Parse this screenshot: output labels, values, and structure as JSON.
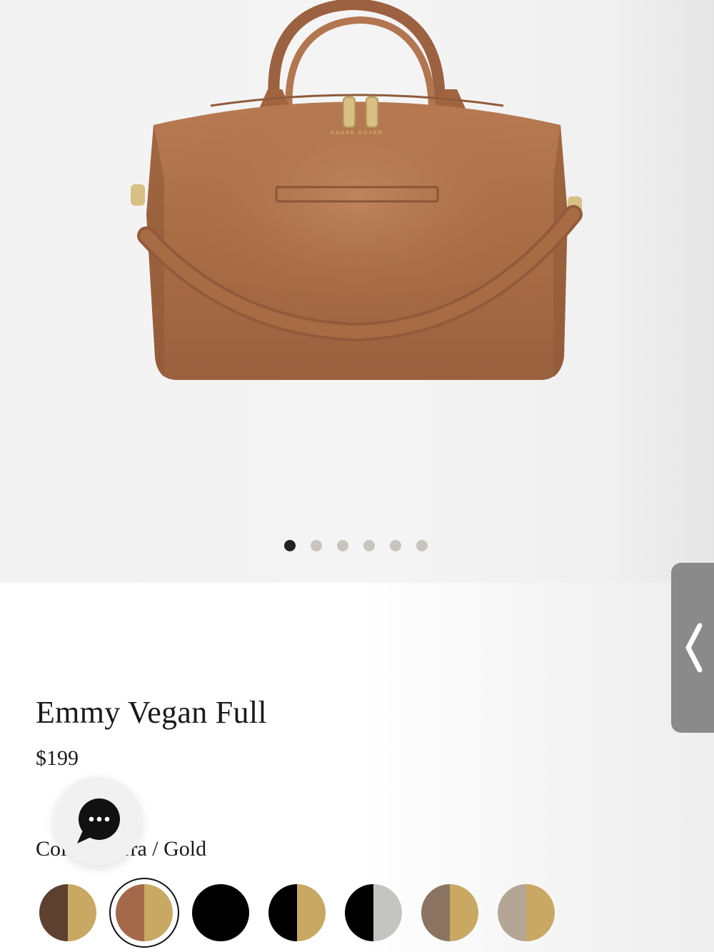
{
  "product": {
    "title": "Emmy Vegan Full",
    "price": "$199",
    "color_label": "Color: Sierra / Gold",
    "brand_mark": "DAGNE DOVER"
  },
  "gallery": {
    "image_count": 6,
    "active_index": 0
  },
  "icons": {
    "chat": "chat-bubble-icon",
    "side_handle": "chevron-left-icon"
  },
  "swatches": [
    {
      "name": "dark-brown-gold",
      "left": "#5e4030",
      "right": "#c8a862",
      "selected": false
    },
    {
      "name": "sierra-gold",
      "left": "#a4694a",
      "right": "#c8a862",
      "selected": true
    },
    {
      "name": "black",
      "left": "#000000",
      "right": "#000000",
      "selected": false
    },
    {
      "name": "black-gold",
      "left": "#000000",
      "right": "#c8a862",
      "selected": false
    },
    {
      "name": "black-silver",
      "left": "#000000",
      "right": "#c4c4c1",
      "selected": false
    },
    {
      "name": "taupe-gold",
      "left": "#8a7461",
      "right": "#c8a862",
      "selected": false
    },
    {
      "name": "stone-gold",
      "left": "#b4a696",
      "right": "#c8a862",
      "selected": false
    }
  ],
  "colors": {
    "bag": "#a86c45",
    "hardware": "#d8bf84",
    "dot_active": "#222222",
    "dot_inactive": "#c9c4bc",
    "side_handle": "#8a8a8a"
  }
}
